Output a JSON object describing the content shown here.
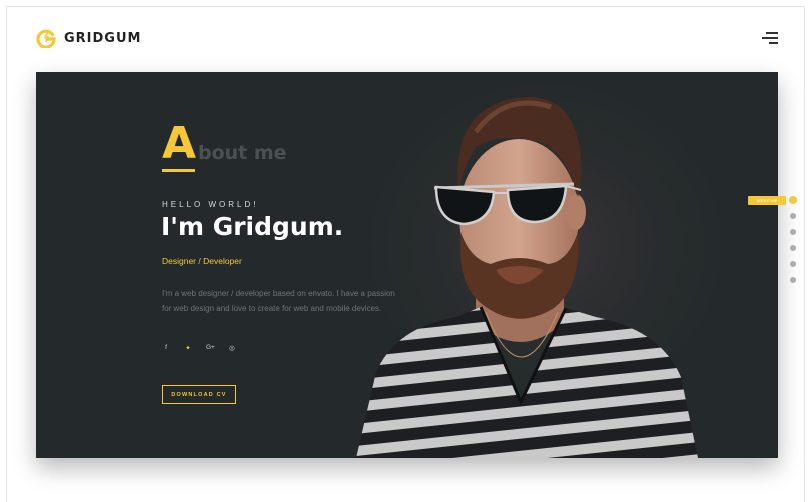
{
  "brand": {
    "name": "GRIDGUM"
  },
  "nav": {
    "menu_icon": "hamburger-menu-icon"
  },
  "hero": {
    "heading_initial": "A",
    "heading_rest": "bout me",
    "greeting": "HELLO WORLD!",
    "name": "I'm Gridgum.",
    "role": "Designer / Developer",
    "bio": "I'm a web designer / developer based on envato. I have a passion for web design and love to create for web and mobile devices.",
    "socials": [
      {
        "icon": "facebook-icon",
        "glyph": "f"
      },
      {
        "icon": "twitter-icon",
        "glyph": "✦"
      },
      {
        "icon": "google-plus-icon",
        "glyph": "G+"
      },
      {
        "icon": "dribbble-icon",
        "glyph": "◎"
      }
    ],
    "cv_button": "DOWNLOAD CV"
  },
  "section_nav": {
    "active_tooltip": "ABOUT ME",
    "items": 6,
    "active_index": 0
  },
  "colors": {
    "accent": "#f6c737",
    "hero_bg": "#242a2b"
  }
}
